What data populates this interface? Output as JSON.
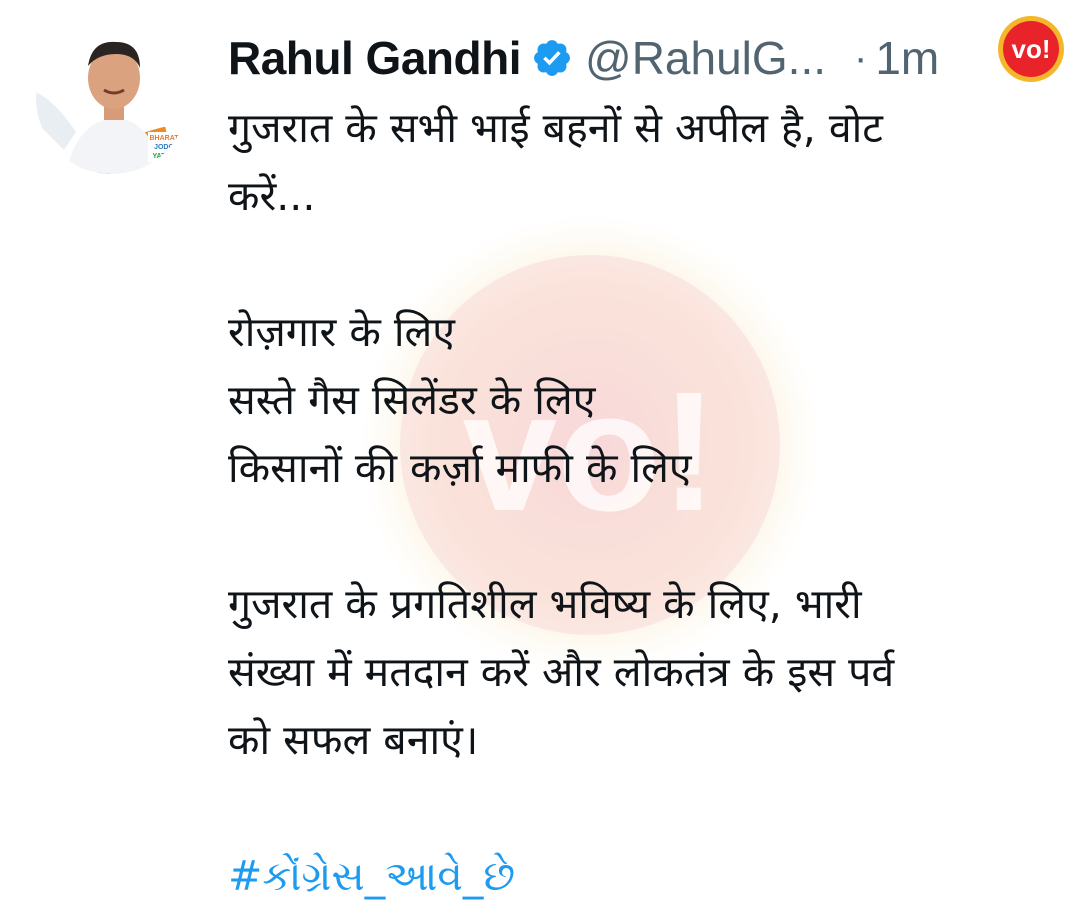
{
  "author": {
    "name": "Rahul Gandhi",
    "handle": "@RahulG...",
    "separator": "·",
    "time": "1m",
    "avatar_icon": "profile-photo",
    "avatar_badge_text": [
      "BHARAT",
      "JODO",
      "YATRA"
    ]
  },
  "verified_icon": "verified-badge-icon",
  "brand": {
    "logo_text": "vo!",
    "logo_color": "#e8232a",
    "watermark_text": "vo!"
  },
  "tweet": {
    "lines": [
      "गुजरात के सभी भाई बहनों से अपील है, वोट",
      "करें...",
      "",
      "रोज़गार के लिए",
      "सस्ते गैस सिलेंडर के लिए",
      "किसानों की कर्ज़ा माफी के लिए",
      "",
      "गुजरात के प्रगतिशील भविष्य के लिए, भारी",
      "संख्या में मतदान करें और लोकतंत्र के इस पर्व",
      "को सफल बनाएं।",
      ""
    ],
    "hashtag": "#કોંગ્રેસ_આવે_છે"
  },
  "colors": {
    "text": "#0f1419",
    "muted": "#536471",
    "link": "#1d9bf0",
    "verified": "#1d9bf0"
  }
}
